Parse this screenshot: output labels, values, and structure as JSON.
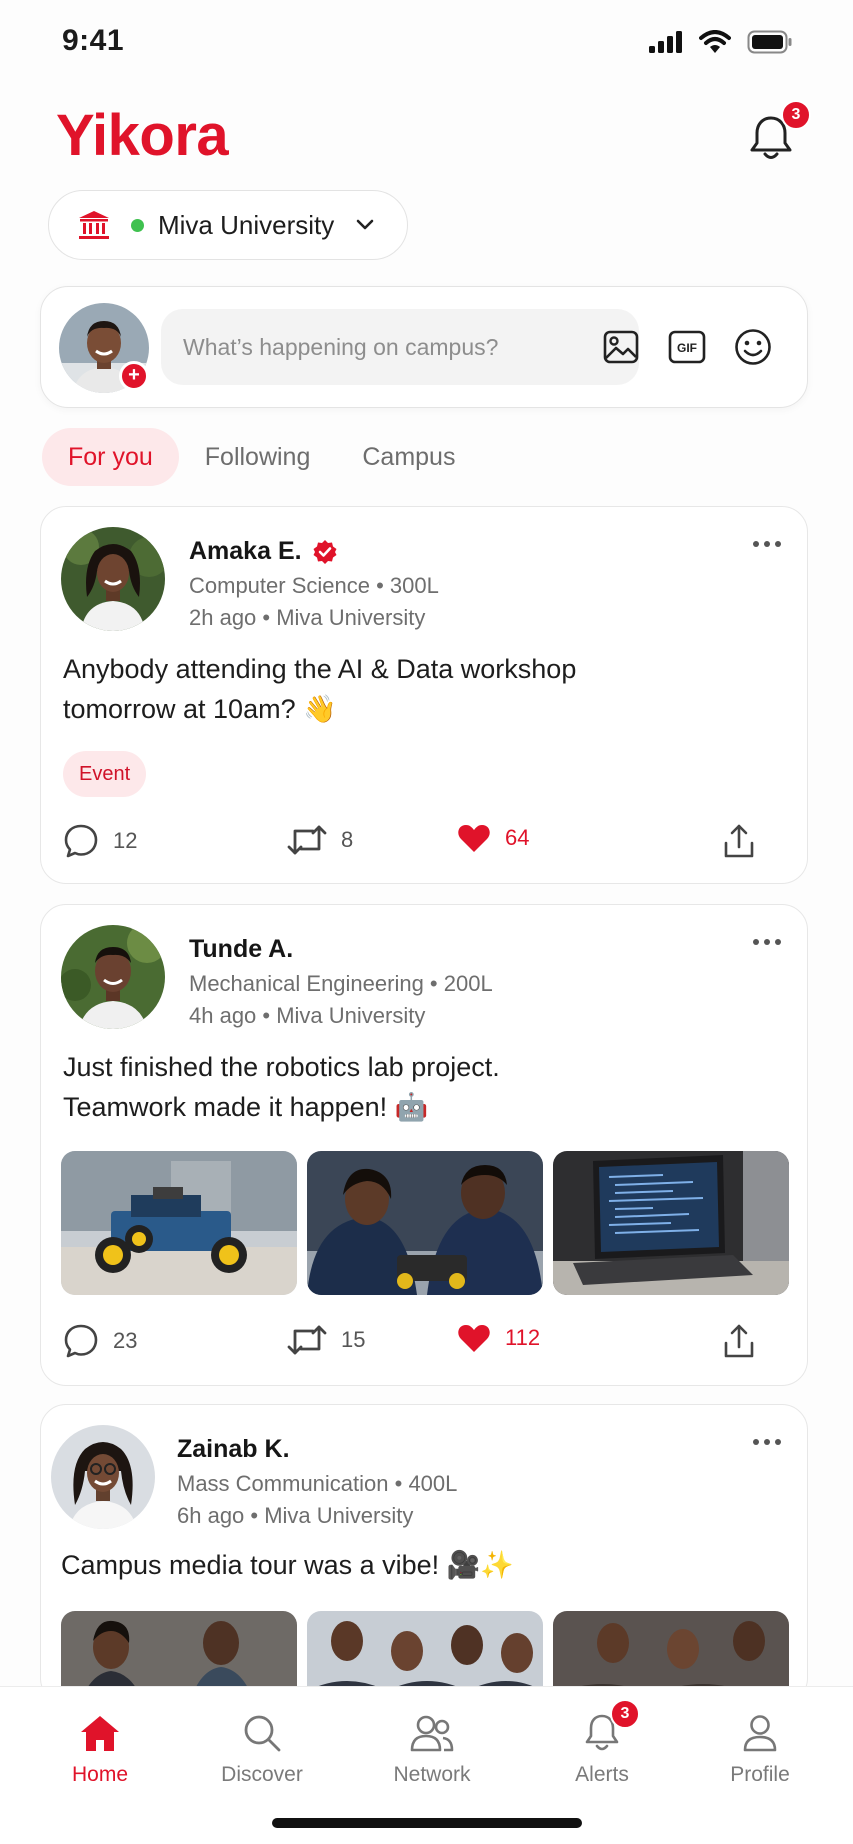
{
  "status_bar": {
    "time": "9:41"
  },
  "app": {
    "title": "Yikora",
    "notifications_count": "3"
  },
  "university": {
    "name": "Miva University",
    "online_color": "#3fc14f"
  },
  "composer": {
    "placeholder": "What’s happening on campus?",
    "gif_label": "GIF"
  },
  "tabs": [
    {
      "label": "For you",
      "active": true
    },
    {
      "label": "Following",
      "active": false
    },
    {
      "label": "Campus",
      "active": false
    }
  ],
  "posts": [
    {
      "author": "Amaka E.",
      "verified": true,
      "dept": "Computer Science • 300L",
      "time": "2h ago • Miva University",
      "text_line1": "Anybody attending the AI & Data workshop",
      "text_line2": "tomorrow at 10am? 👋",
      "tag": "Event",
      "comments": "12",
      "reposts": "8",
      "likes": "64"
    },
    {
      "author": "Tunde A.",
      "dept": "Mechanical Engineering • 200L",
      "time": "4h ago • Miva University",
      "text_line1": "Just finished the robotics lab project.",
      "text_line2": "Teamwork made it happen! 🤖",
      "comments": "23",
      "reposts": "15",
      "likes": "112"
    },
    {
      "author": "Zainab K.",
      "dept": "Mass Communication • 400L",
      "time": "6h ago • Miva University",
      "text_line1": "Campus media tour was a vibe! 🎥✨"
    }
  ],
  "bottom_nav": [
    {
      "label": "Home",
      "icon": "home-icon",
      "active": true
    },
    {
      "label": "Discover",
      "icon": "search-icon"
    },
    {
      "label": "Network",
      "icon": "people-icon"
    },
    {
      "label": "Alerts",
      "icon": "bell-icon",
      "badge": "3"
    },
    {
      "label": "Profile",
      "icon": "person-icon"
    }
  ],
  "colors": {
    "brand": "#e0132a",
    "tab_active_bg": "#fde8ea",
    "text_muted": "#6e6e6e"
  }
}
